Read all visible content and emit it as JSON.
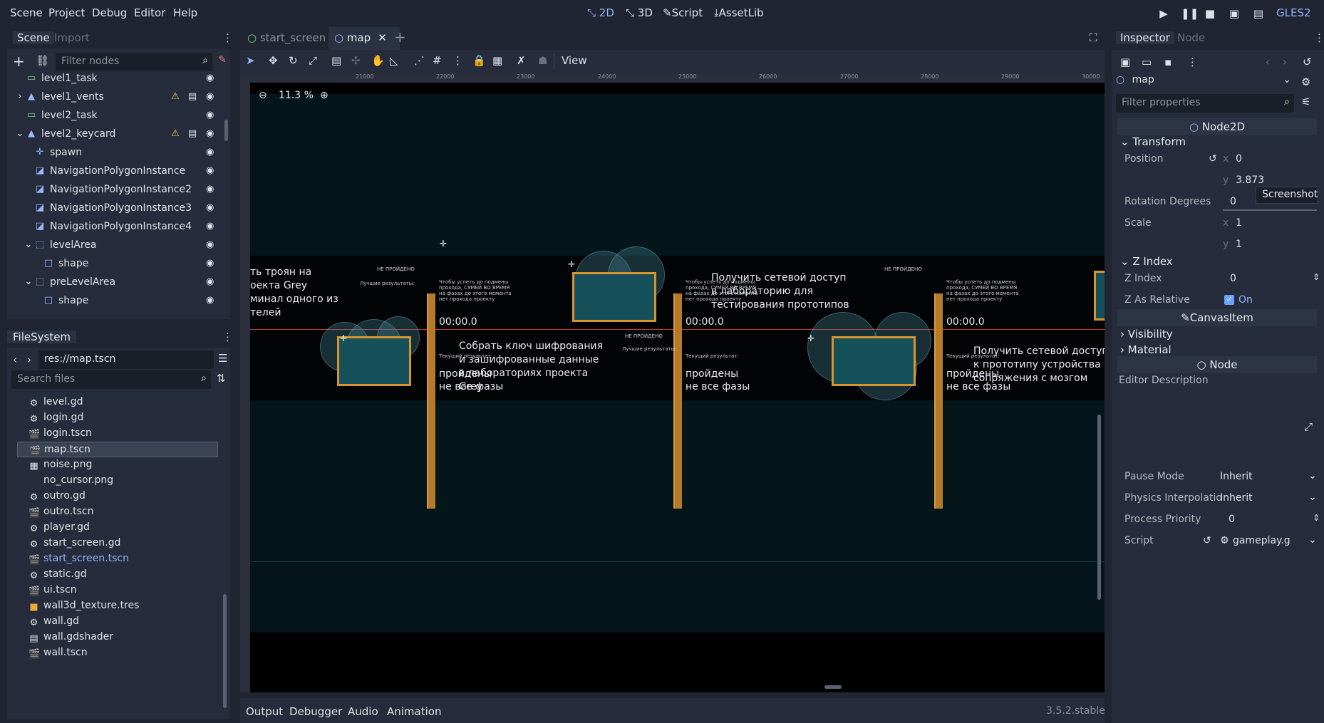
{
  "menu": [
    "Scene",
    "Project",
    "Debug",
    "Editor",
    "Help"
  ],
  "modes": [
    {
      "label": "2D",
      "active": true
    },
    {
      "label": "3D",
      "active": false
    },
    {
      "label": "Script",
      "active": false
    },
    {
      "label": "AssetLib",
      "active": false
    }
  ],
  "renderer": "GLES2",
  "scene_dock": {
    "tabs": [
      "Scene",
      "Import"
    ],
    "filter_placeholder": "Filter nodes",
    "nodes": [
      {
        "label": "level1_task",
        "icon": "label-icon",
        "indent": 1,
        "warn": false,
        "script": false
      },
      {
        "label": "level1_vents",
        "icon": "sprite-icon",
        "indent": 1,
        "warn": true,
        "script": true,
        "arrow": "›"
      },
      {
        "label": "level2_task",
        "icon": "label-icon",
        "indent": 1,
        "warn": false,
        "script": false
      },
      {
        "label": "level2_keycard",
        "icon": "sprite-icon",
        "indent": 1,
        "warn": true,
        "script": true,
        "arrow": "⌄"
      },
      {
        "label": "spawn",
        "icon": "position-icon",
        "indent": 2,
        "warn": false,
        "script": false
      },
      {
        "label": "NavigationPolygonInstance",
        "icon": "navpoly-icon",
        "indent": 2,
        "warn": false,
        "script": false
      },
      {
        "label": "NavigationPolygonInstance2",
        "icon": "navpoly-icon",
        "indent": 2,
        "warn": false,
        "script": false
      },
      {
        "label": "NavigationPolygonInstance3",
        "icon": "navpoly-icon",
        "indent": 2,
        "warn": false,
        "script": false
      },
      {
        "label": "NavigationPolygonInstance4",
        "icon": "navpoly-icon",
        "indent": 2,
        "warn": false,
        "script": false
      },
      {
        "label": "levelArea",
        "icon": "area-icon",
        "indent": 2,
        "warn": false,
        "script": false,
        "arrow": "⌄"
      },
      {
        "label": "shape",
        "icon": "shape-icon",
        "indent": 3,
        "warn": false,
        "script": false
      },
      {
        "label": "preLevelArea",
        "icon": "area-icon",
        "indent": 2,
        "warn": false,
        "script": false,
        "arrow": "⌄"
      },
      {
        "label": "shape",
        "icon": "shape-icon",
        "indent": 3,
        "warn": false,
        "script": false
      }
    ]
  },
  "filesystem": {
    "tab": "FileSystem",
    "path": "res://map.tscn",
    "search_placeholder": "Search files",
    "files": [
      {
        "name": "level.gd",
        "type": "gd"
      },
      {
        "name": "login.gd",
        "type": "gd"
      },
      {
        "name": "login.tscn",
        "type": "tscn"
      },
      {
        "name": "map.tscn",
        "type": "tscn",
        "selected": true
      },
      {
        "name": "noise.png",
        "type": "png"
      },
      {
        "name": "no_cursor.png",
        "type": "none"
      },
      {
        "name": "outro.gd",
        "type": "gd"
      },
      {
        "name": "outro.tscn",
        "type": "tscn"
      },
      {
        "name": "player.gd",
        "type": "gd"
      },
      {
        "name": "start_screen.gd",
        "type": "gd"
      },
      {
        "name": "start_screen.tscn",
        "type": "tscn",
        "highlight": true
      },
      {
        "name": "static.gd",
        "type": "gd"
      },
      {
        "name": "ui.tscn",
        "type": "tscn"
      },
      {
        "name": "wall3d_texture.tres",
        "type": "tres"
      },
      {
        "name": "wall.gd",
        "type": "gd"
      },
      {
        "name": "wall.gdshader",
        "type": "shader"
      },
      {
        "name": "wall.tscn",
        "type": "tscn"
      }
    ]
  },
  "editor_tabs": [
    {
      "label": "start_screen",
      "active": false
    },
    {
      "label": "map",
      "active": true
    }
  ],
  "toolbar": {
    "view_label": "View"
  },
  "viewport": {
    "zoom": "11.3 %",
    "ruler_labels": [
      "21000",
      "22000",
      "23000",
      "24000",
      "25000",
      "26000",
      "27000",
      "28000",
      "29000",
      "30000"
    ],
    "vruler_labels": [
      "-2000",
      "-1000",
      "0",
      "1000",
      "2000",
      "3000",
      "4000"
    ],
    "texts": {
      "t1": "ть троян на\nоекта Grey\nминал одного из\nтелей",
      "t2": "Собрать ключ шифрования\nи зашифрованные данные\nв лабораториях проекта\nGrey",
      "t3": "Получить сетевой доступ\nв лабораторию для\nтестирования прототипов",
      "t4": "Получить сетевой доступ\nк прототипу устройства\nсопряжения с мозгом",
      "timer": "00:00.0",
      "passed_a": "пройдены",
      "passed_b": "не все фазы",
      "not_passed": "НЕ ПРОЙДЕНО",
      "current_result": "Текущий результат:",
      "best_results": "Лучшие результаты:",
      "small_para": "Чтобы успеть до подмены\nпрохода, СУМЕЙ ВО ВРЕМЯ\nна фазах до этого момента\nнет прохода проекту"
    }
  },
  "bottom_tabs": [
    "Output",
    "Debugger",
    "Audio",
    "Animation"
  ],
  "version": "3.5.2.stable",
  "inspector": {
    "tabs": [
      "Inspector",
      "Node"
    ],
    "object_name": "map",
    "filter_placeholder": "Filter properties",
    "class_node2d": "Node2D",
    "transform": "Transform",
    "position_label": "Position",
    "position_x": "0",
    "position_y": "3.873",
    "rotation_label": "Rotation Degrees",
    "rotation_value": "0",
    "scale_label": "Scale",
    "scale_x": "1",
    "scale_y": "1",
    "zindex_section": "Z Index",
    "zindex_label": "Z Index",
    "zindex_value": "0",
    "zrel_label": "Z As Relative",
    "zrel_value": "On",
    "canvasitem": "CanvasItem",
    "visibility": "Visibility",
    "material": "Material",
    "class_node": "Node",
    "editor_desc": "Editor Description",
    "pause_label": "Pause Mode",
    "pause_value": "Inherit",
    "phys_label": "Physics Interpolatio",
    "phys_value": "Inherit",
    "prio_label": "Process Priority",
    "prio_value": "0",
    "script_label": "Script",
    "script_value": "gameplay.g",
    "tooltip": "Screenshot"
  }
}
